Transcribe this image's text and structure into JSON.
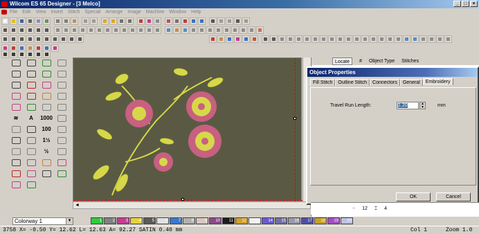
{
  "app": {
    "title": "Wilcom ES 65 Designer - [3     Melco]"
  },
  "menu": [
    "File",
    "Edit",
    "View",
    "Insert",
    "Stitch",
    "Special",
    "Arrange",
    "Image",
    "Machine",
    "Window",
    "Help"
  ],
  "window_buttons": [
    "_",
    "□",
    "×"
  ],
  "object_panel": {
    "locate_label": "Locate",
    "hash": "#",
    "object_type": "Object Type",
    "stitches": "Stitches",
    "row": {
      "num": "12",
      "count": "4"
    }
  },
  "dialog": {
    "title": "Object Properties",
    "tabs": [
      "Fill Stitch",
      "Outline Stitch",
      "Connectors",
      "General",
      "Embroidery"
    ],
    "active_tab": "Embroidery",
    "travel_run_label": "Travel Run Length:",
    "travel_run_value": "1.20",
    "unit": "mm",
    "ok": "OK",
    "cancel": "Cancel"
  },
  "colorway": {
    "label": "Colorway 1"
  },
  "swatches": [
    {
      "n": "1",
      "c": "#2ecc40"
    },
    {
      "n": "2",
      "c": "#808080"
    },
    {
      "n": "3",
      "c": "#c04090"
    },
    {
      "n": "4",
      "c": "#e6d23c"
    },
    {
      "n": "5",
      "c": "#5a5a5a"
    },
    {
      "n": "6",
      "c": "#e0e0e0"
    },
    {
      "n": "7",
      "c": "#3c78c8"
    },
    {
      "n": "8",
      "c": "#b0b0b0"
    },
    {
      "n": "9",
      "c": "#d8c8c0"
    },
    {
      "n": "10",
      "c": "#8a4a8a"
    },
    {
      "n": "11",
      "c": "#1c1c1c"
    },
    {
      "n": "12",
      "c": "#d0a030"
    },
    {
      "n": "13",
      "c": "#f0f0f0"
    },
    {
      "n": "14",
      "c": "#6a5acd"
    },
    {
      "n": "15",
      "c": "#7070a0"
    },
    {
      "n": "16",
      "c": "#9a9aaa"
    },
    {
      "n": "17",
      "c": "#5050a0"
    },
    {
      "n": "18",
      "c": "#c8a028"
    },
    {
      "n": "19",
      "c": "#a050c0"
    },
    {
      "n": "20",
      "c": "#c0c0e0"
    }
  ],
  "status": {
    "left": "3758 X=  -0.50 Y=  12.62 L=  12.63 A=  92.27 SATIN  0.40 mm",
    "col": "Col 1",
    "zoom": "Zoom 1.0"
  },
  "colors": {
    "canvas": "#5a5a44",
    "petal": "#c86080",
    "leaf": "#d6d84a"
  }
}
